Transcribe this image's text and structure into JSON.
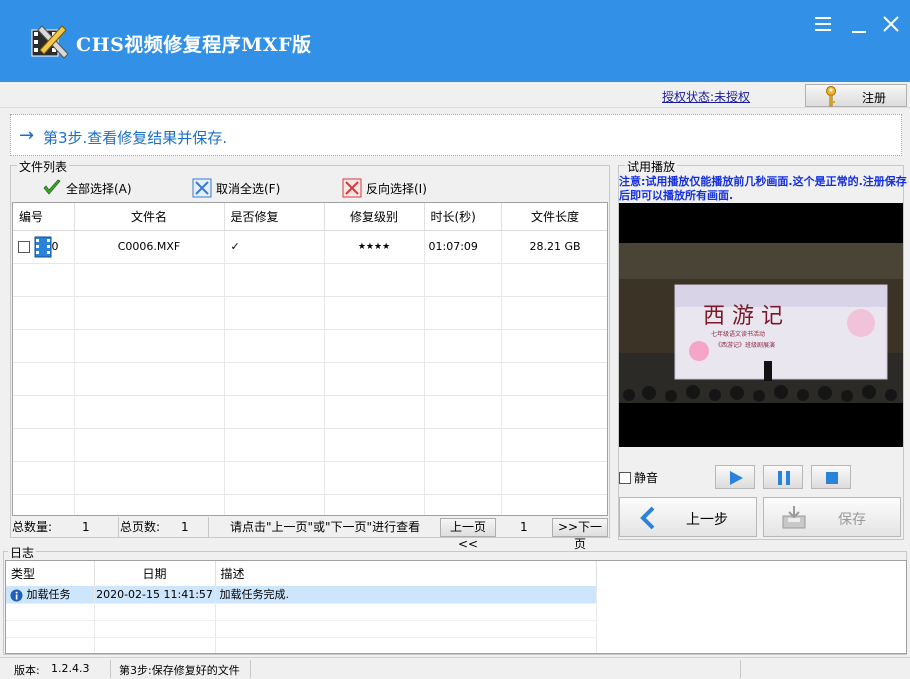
{
  "app": {
    "title": "CHS视频修复程序MXF版"
  },
  "auth": {
    "status_link": "授权状态:未授权",
    "register_label": "注册"
  },
  "step": {
    "text": "第3步.查看修复结果并保存."
  },
  "filelist": {
    "group_title": "文件列表",
    "actions": {
      "select_all": "全部选择(A)",
      "deselect_all": "取消全选(F)",
      "invert": "反向选择(I)"
    },
    "columns": [
      "编号",
      "文件名",
      "是否修复",
      "修复级别",
      "时长(秒)",
      "文件长度"
    ],
    "rows": [
      {
        "index": "0",
        "filename": "C0006.MXF",
        "repaired": "✓",
        "level": "★★★★",
        "duration": "01:07:09",
        "size": "28.21 GB"
      }
    ]
  },
  "pager": {
    "total_label": "总数量:",
    "total": "1",
    "pages_label": "总页数:",
    "pages": "1",
    "hint": "请点击\"上一页\"或\"下一页\"进行查看",
    "prev": "上一页<<",
    "current": "1",
    "next": ">>下一页"
  },
  "preview": {
    "group_title": "试用播放",
    "notice": "注意:试用播放仅能播放前几秒画面.这个是正常的.注册保存后即可以播放所有画面.",
    "video_title": "西 游 记",
    "video_subtitle_1": "七年级语文读书活动",
    "video_subtitle_2": "《西游记》班级剧展演",
    "mute_label": "静音"
  },
  "nav": {
    "prev_label": "上一步",
    "save_label": "保存"
  },
  "log": {
    "group_title": "日志",
    "columns": [
      "类型",
      "日期",
      "描述"
    ],
    "rows": [
      {
        "type": "加载任务",
        "date": "2020-02-15 11:41:57",
        "desc": "加载任务完成."
      }
    ]
  },
  "status": {
    "version_label": "版本:",
    "version": "1.2.4.3",
    "message": "第3步:保存修复好的文件"
  },
  "colors": {
    "titlebar": "#3291e6",
    "accent": "#1b6fc8",
    "notice": "#1530e0",
    "selection": "#cde6fb"
  }
}
